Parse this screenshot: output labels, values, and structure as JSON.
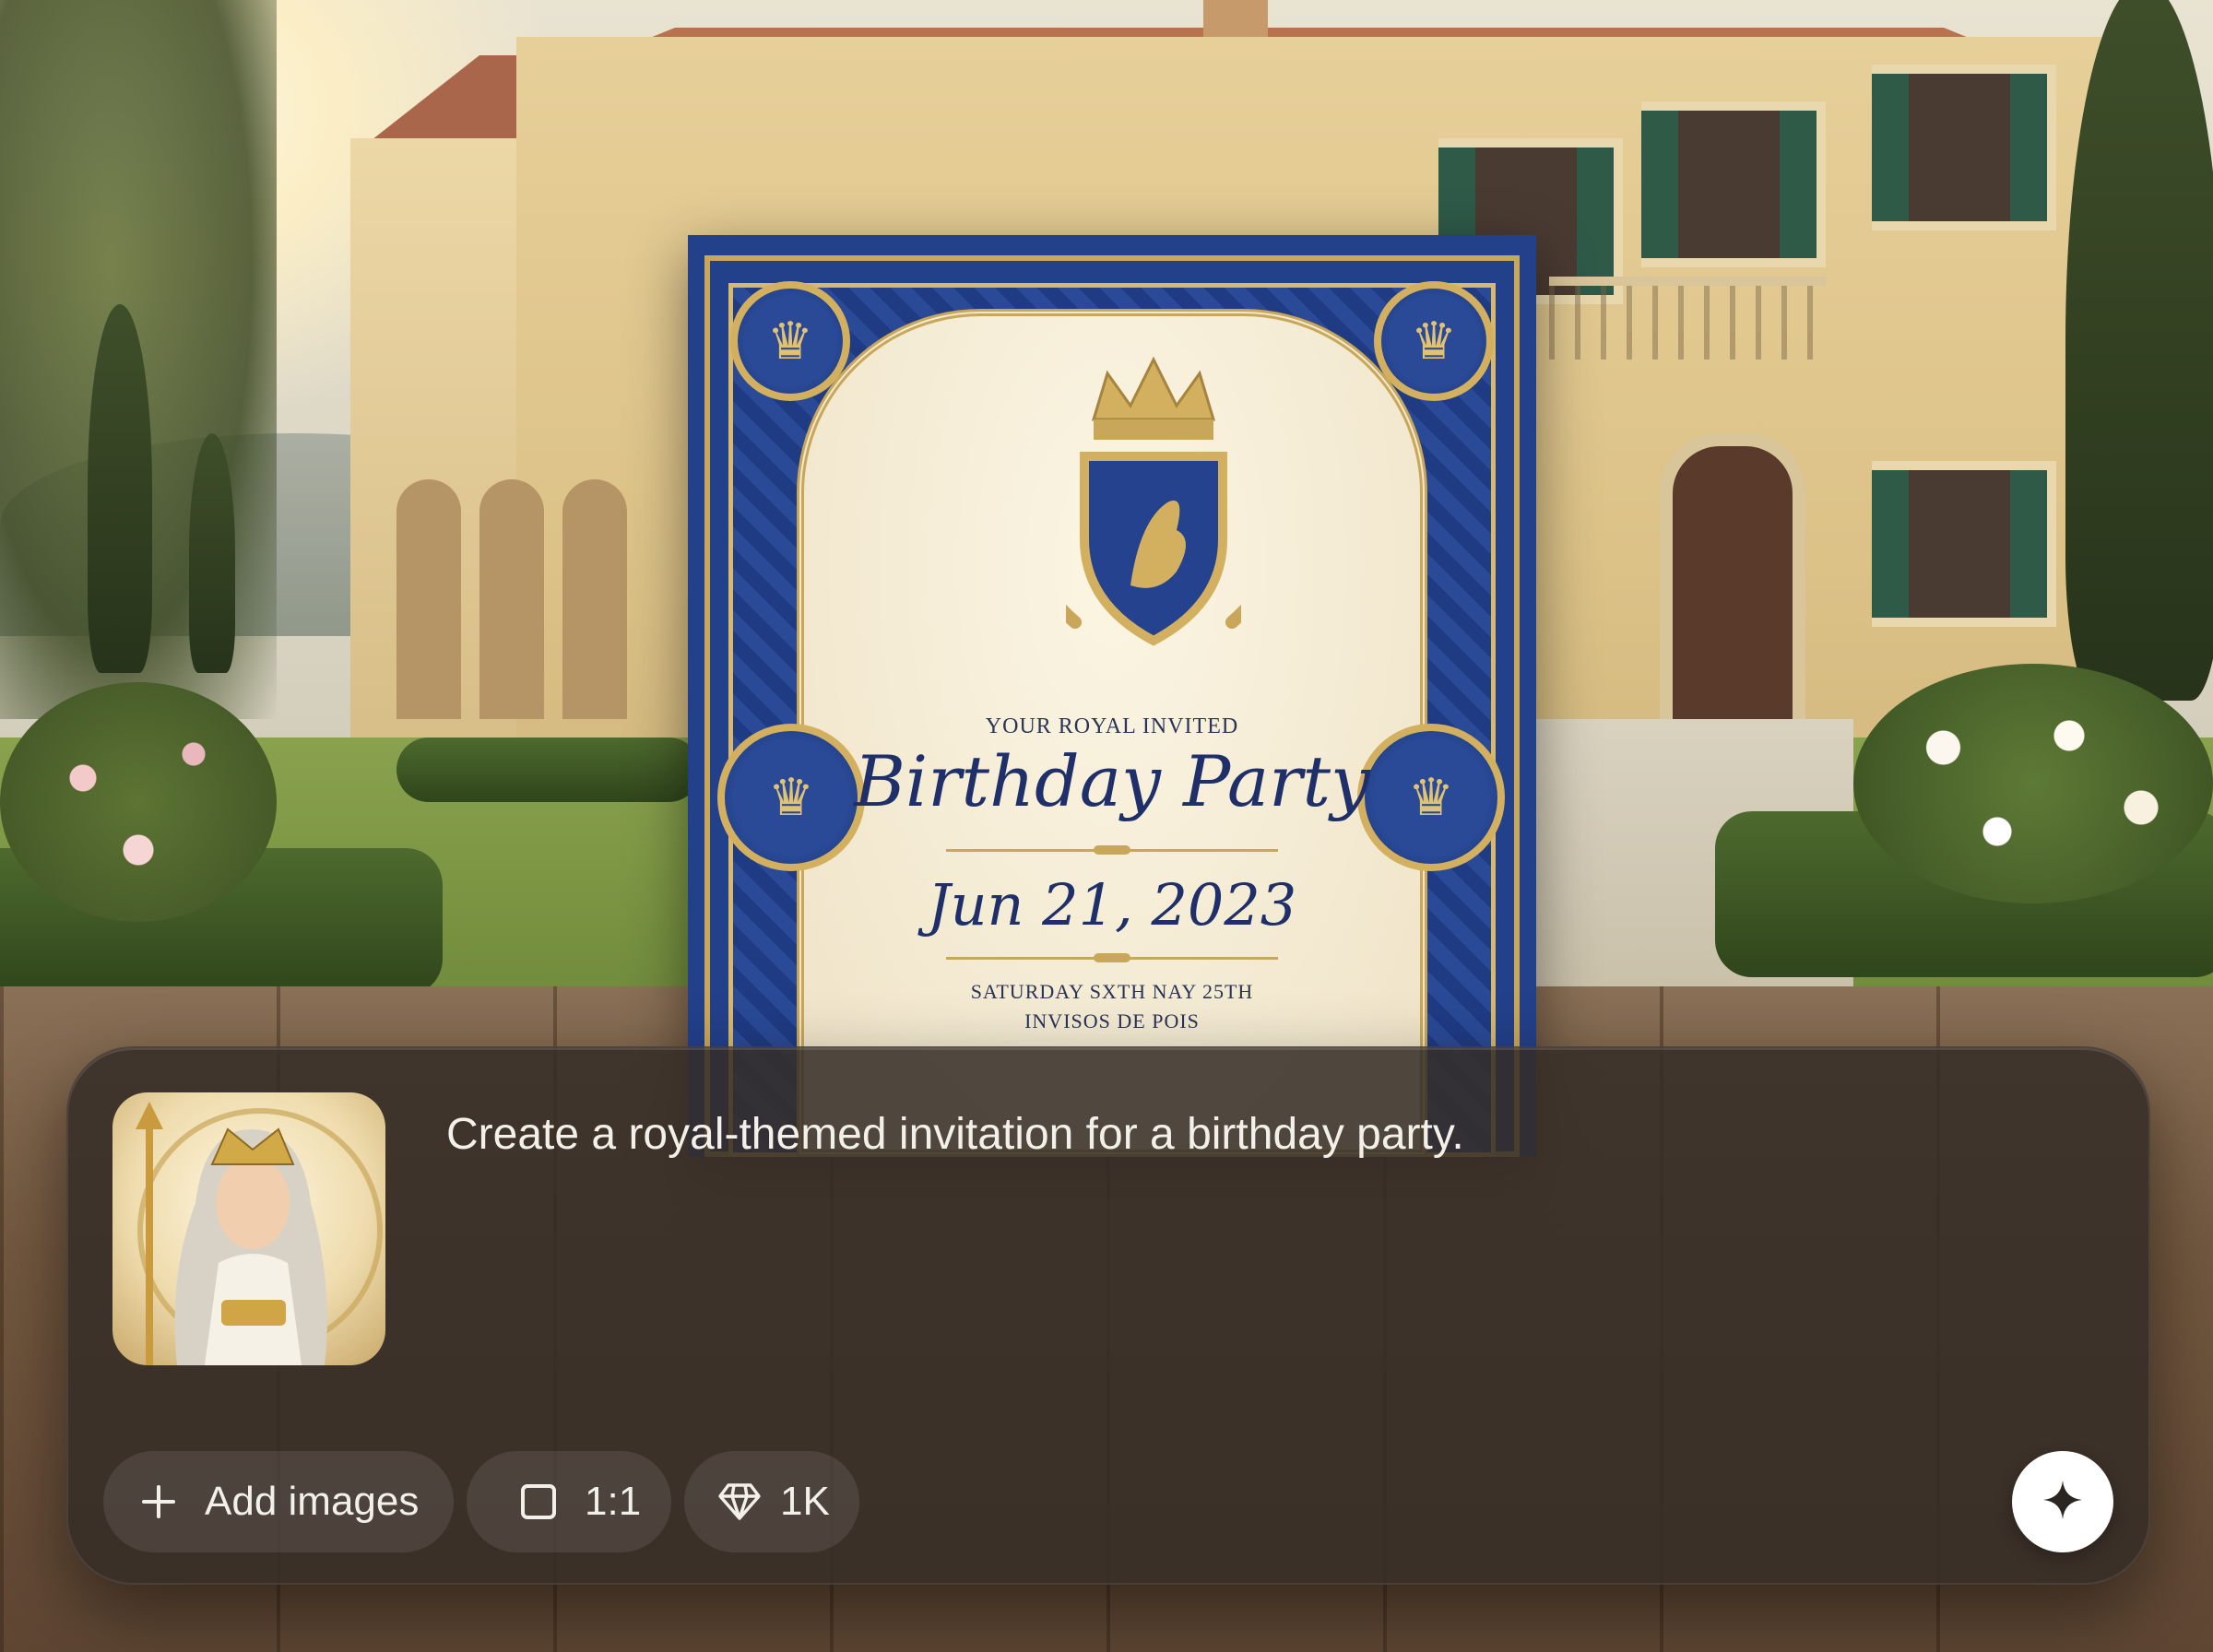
{
  "invitation": {
    "kicker": "YOUR ROYAL INVITED",
    "title": "Birthday Party",
    "date": "Jun 21, 2023",
    "line1": "SATURDAY SXTH NAY 25TH",
    "line2": "INVISOS DE POIS"
  },
  "prompt": {
    "text": "Create a royal-themed invitation for a birthday party.",
    "reference_image_icon": "portrait-thumbnail"
  },
  "toolbar": {
    "add_images": {
      "label": "Add images",
      "icon": "plus-icon"
    },
    "aspect_ratio": {
      "label": "1:1",
      "icon": "square-icon"
    },
    "resolution": {
      "label": "1K",
      "icon": "diamond-icon"
    },
    "generate": {
      "icon": "sparkle-icon"
    }
  },
  "colors": {
    "card_navy": "#23408a",
    "gold": "#c9a75a",
    "panel_bg": "#342c26",
    "text_light": "#f3f0ea"
  }
}
